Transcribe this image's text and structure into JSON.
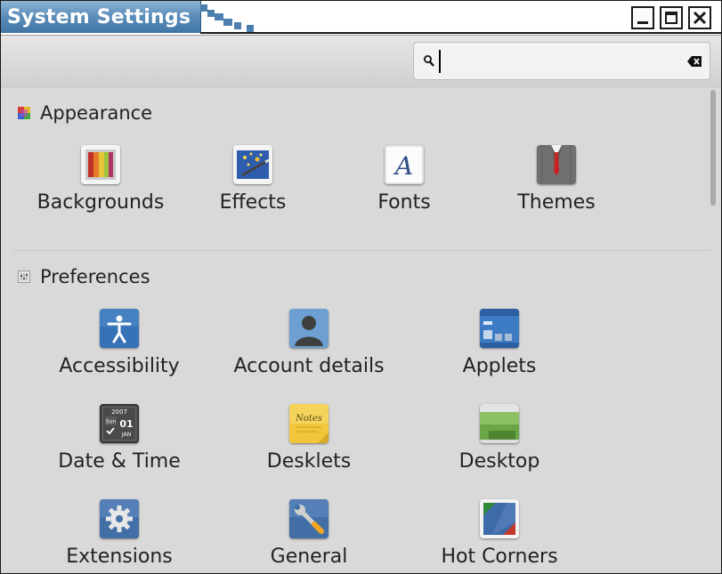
{
  "window": {
    "title": "System Settings"
  },
  "search": {
    "value": "",
    "placeholder": ""
  },
  "icons": {
    "search": "magnifier-icon",
    "clear": "backspace-clear-icon",
    "minimize": "minimize-icon",
    "maximize": "maximize-icon",
    "close": "close-icon"
  },
  "colors": {
    "titlebar_accent": "#4d7fae",
    "background": "#d9d9d9"
  },
  "sections": [
    {
      "title": "Appearance",
      "items": [
        {
          "label": "Backgrounds",
          "icon": "backgrounds-icon"
        },
        {
          "label": "Effects",
          "icon": "effects-icon"
        },
        {
          "label": "Fonts",
          "icon": "fonts-icon"
        },
        {
          "label": "Themes",
          "icon": "themes-icon"
        }
      ]
    },
    {
      "title": "Preferences",
      "items": [
        {
          "label": "Accessibility",
          "icon": "accessibility-icon"
        },
        {
          "label": "Account details",
          "icon": "account-details-icon"
        },
        {
          "label": "Applets",
          "icon": "applets-icon"
        },
        {
          "label": "Date & Time",
          "icon": "date-time-icon",
          "icon_text": [
            "2007",
            "Sun",
            "01",
            "JAN"
          ]
        },
        {
          "label": "Desklets",
          "icon": "desklets-icon",
          "icon_text": "Notes"
        },
        {
          "label": "Desktop",
          "icon": "desktop-icon"
        },
        {
          "label": "Extensions",
          "icon": "extensions-icon"
        },
        {
          "label": "General",
          "icon": "general-icon"
        },
        {
          "label": "Hot Corners",
          "icon": "hot-corners-icon"
        }
      ]
    }
  ]
}
